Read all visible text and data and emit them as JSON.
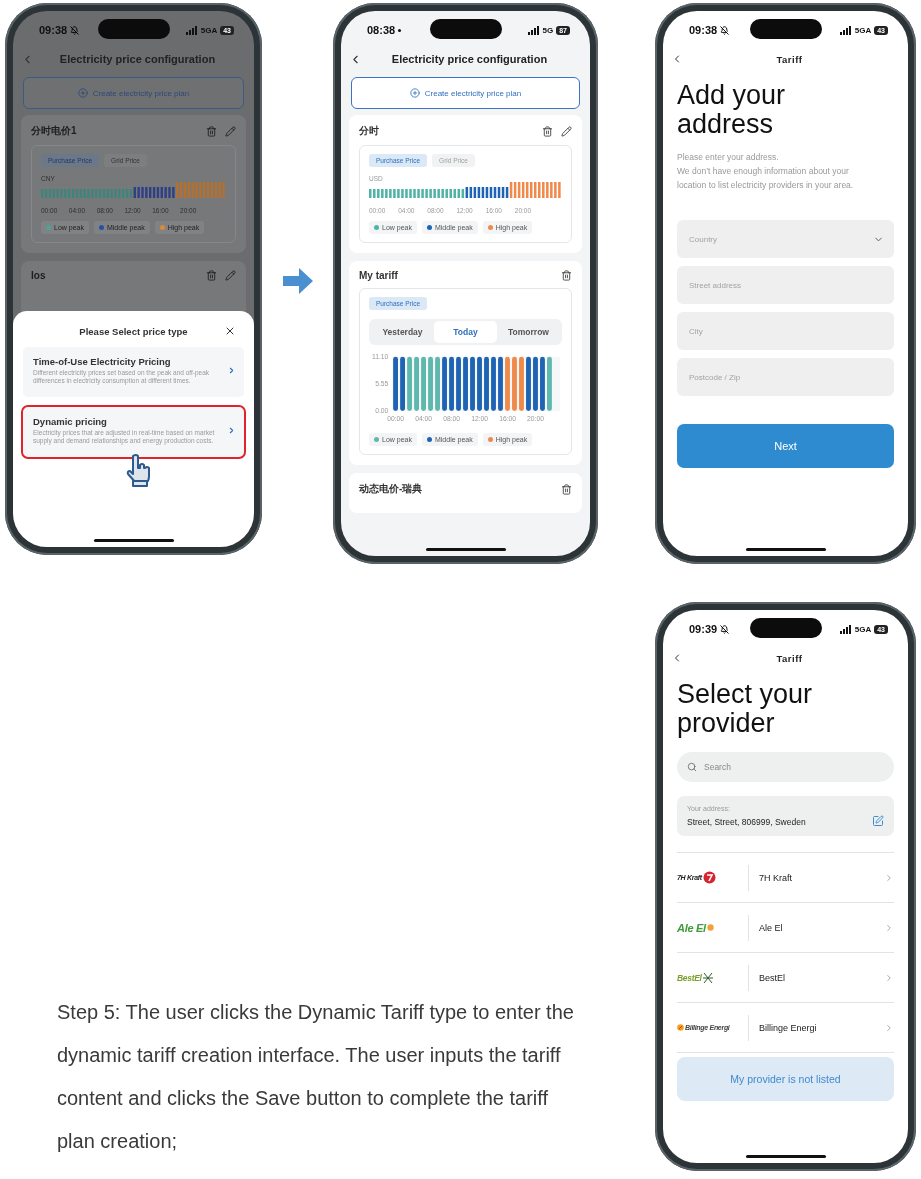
{
  "screens": [
    {
      "kind": "price_config",
      "status": {
        "time": "09:38",
        "silent": true,
        "network": "5GA",
        "battery": "43"
      },
      "title": "Electricity price configuration",
      "create_button": "Create electricity price plan",
      "dimmed": true,
      "plans": [
        {
          "kind": "time_of_use",
          "name": "分时电价1",
          "editable": true,
          "tabs": [
            {
              "label": "Purchase Price",
              "selected": true
            },
            {
              "label": "Grid Price",
              "selected": false
            }
          ],
          "currency": "CNY",
          "axis_labels": [
            "00:00",
            "04:00",
            "08:00",
            "12:00",
            "16:00",
            "20:00"
          ],
          "legend": [
            {
              "label": "Low peak",
              "color": "#4aa596"
            },
            {
              "label": "Middle peak",
              "color": "#2b4fa8"
            },
            {
              "label": "High peak",
              "color": "#d98a3a"
            }
          ]
        },
        {
          "kind": "collapsed",
          "name": "Ios",
          "editable": true
        }
      ],
      "sheet": {
        "title": "Please Select price type",
        "options": [
          {
            "title": "Time-of-Use Electricity Pricing",
            "description": "Different electricity prices set based on the peak and off-peak differences in electricity consumption at different times.",
            "highlighted": false
          },
          {
            "title": "Dynamic pricing",
            "description": "Electricity prices that are adjusted in real-time based on market supply and demand relationships and energy production costs.",
            "highlighted": true
          }
        ]
      }
    },
    {
      "kind": "price_config",
      "status": {
        "time": "08:38",
        "silent": false,
        "network": "5G",
        "battery": "87"
      },
      "title": "Electricity price configuration",
      "create_button": "Create electricity price plan",
      "dimmed": false,
      "plans": [
        {
          "kind": "time_of_use",
          "name": "分时",
          "editable": true,
          "tabs": [
            {
              "label": "Purchase Price",
              "selected": true
            },
            {
              "label": "Grid Price",
              "selected": false
            }
          ],
          "currency": "USD",
          "axis_labels": [
            "00:00",
            "04:00",
            "08:00",
            "12:00",
            "16:00",
            "20:00"
          ],
          "legend": [
            {
              "label": "Low peak",
              "color": "#4fb3a6"
            },
            {
              "label": "Middle peak",
              "color": "#1f64b4"
            },
            {
              "label": "High peak",
              "color": "#f08a4b"
            }
          ]
        },
        {
          "kind": "dynamic",
          "name": "My tariff",
          "editable": false,
          "tabs": [
            {
              "label": "Purchase Price",
              "selected": true
            }
          ],
          "day_tabs": [
            {
              "label": "Yesterday",
              "selected": false
            },
            {
              "label": "Today",
              "selected": true
            },
            {
              "label": "Tomorrow",
              "selected": false
            }
          ],
          "chart_data": {
            "type": "bar",
            "x": [
              0,
              1,
              2,
              3,
              4,
              5,
              6,
              7,
              8,
              9,
              10,
              11,
              12,
              13,
              14,
              15,
              16,
              17,
              18,
              19,
              20,
              21,
              22
            ],
            "xlim": [
              -0.5,
              23.5
            ],
            "series": [
              {
                "name": "Low peak",
                "color": "#5fb8ad",
                "values": [
                  null,
                  null,
                  11.1,
                  11.1,
                  11.1,
                  11.1,
                  11.1,
                  null,
                  null,
                  null,
                  null,
                  null,
                  null,
                  null,
                  null,
                  null,
                  null,
                  null,
                  null,
                  null,
                  null,
                  null,
                  11.1
                ]
              },
              {
                "name": "Middle peak",
                "color": "#1f64b4",
                "values": [
                  11.1,
                  11.1,
                  null,
                  null,
                  null,
                  null,
                  null,
                  11.1,
                  11.1,
                  11.1,
                  11.1,
                  11.1,
                  11.1,
                  11.1,
                  11.1,
                  11.1,
                  null,
                  null,
                  null,
                  11.1,
                  11.1,
                  11.1,
                  null
                ]
              },
              {
                "name": "High peak",
                "color": "#f08a4b",
                "values": [
                  null,
                  null,
                  null,
                  null,
                  null,
                  null,
                  null,
                  null,
                  null,
                  null,
                  null,
                  null,
                  null,
                  null,
                  null,
                  null,
                  11.1,
                  11.1,
                  11.1,
                  null,
                  null,
                  null,
                  null
                ]
              }
            ],
            "ylim": [
              0,
              11.1
            ],
            "yticks": [
              {
                "value": 0,
                "label": "0.00"
              },
              {
                "value": 5.55,
                "label": "5.55"
              },
              {
                "value": 11.1,
                "label": "11.10"
              }
            ],
            "xticks": [
              {
                "value": 0,
                "label": "00:00"
              },
              {
                "value": 4,
                "label": "04:00"
              },
              {
                "value": 8,
                "label": "08:00"
              },
              {
                "value": 12,
                "label": "12:00"
              },
              {
                "value": 16,
                "label": "16:00"
              },
              {
                "value": 20,
                "label": "20:00"
              }
            ]
          }
        },
        {
          "kind": "collapsed",
          "name": "动态电价-瑞典",
          "editable": false
        }
      ]
    },
    {
      "kind": "address_form",
      "status": {
        "time": "09:38",
        "silent": true,
        "network": "5GA",
        "battery": "43"
      },
      "title": "Tariff",
      "heading": "Add your address",
      "description": [
        "Please enter your address.",
        "We don’t have enough information about your location to list electricity providers in your area."
      ],
      "fields": [
        {
          "kind": "select",
          "placeholder": "Country"
        },
        {
          "kind": "text",
          "placeholder": "Street address"
        },
        {
          "kind": "text",
          "placeholder": "City"
        },
        {
          "kind": "text",
          "placeholder": "Postcode / Zip"
        }
      ],
      "button": "Next"
    },
    {
      "kind": "provider_list",
      "status": {
        "time": "09:39",
        "silent": true,
        "network": "5GA",
        "battery": "43"
      },
      "title": "Tariff",
      "heading": "Select your provider",
      "search": {
        "placeholder": "Search"
      },
      "address": {
        "label": "Your address:",
        "value": "Street, Street, 806999, Sweden"
      },
      "providers": [
        {
          "kind": "kraft",
          "logo": "7H Kraft",
          "name": "7H Kraft"
        },
        {
          "kind": "ale",
          "logo": "Ale El",
          "name": "Ale El"
        },
        {
          "kind": "best",
          "logo": "BestEl",
          "name": "BestEl"
        },
        {
          "kind": "billinge",
          "logo": "Billinge Energi",
          "name": "Billinge Energi"
        }
      ],
      "button": "My provider is not listed"
    }
  ],
  "caption": "Step 5: The user clicks the Dynamic Tariff type to enter the dynamic tariff creation interface. The user inputs the tariff content and clicks the Save button to complete the tariff plan creation;"
}
